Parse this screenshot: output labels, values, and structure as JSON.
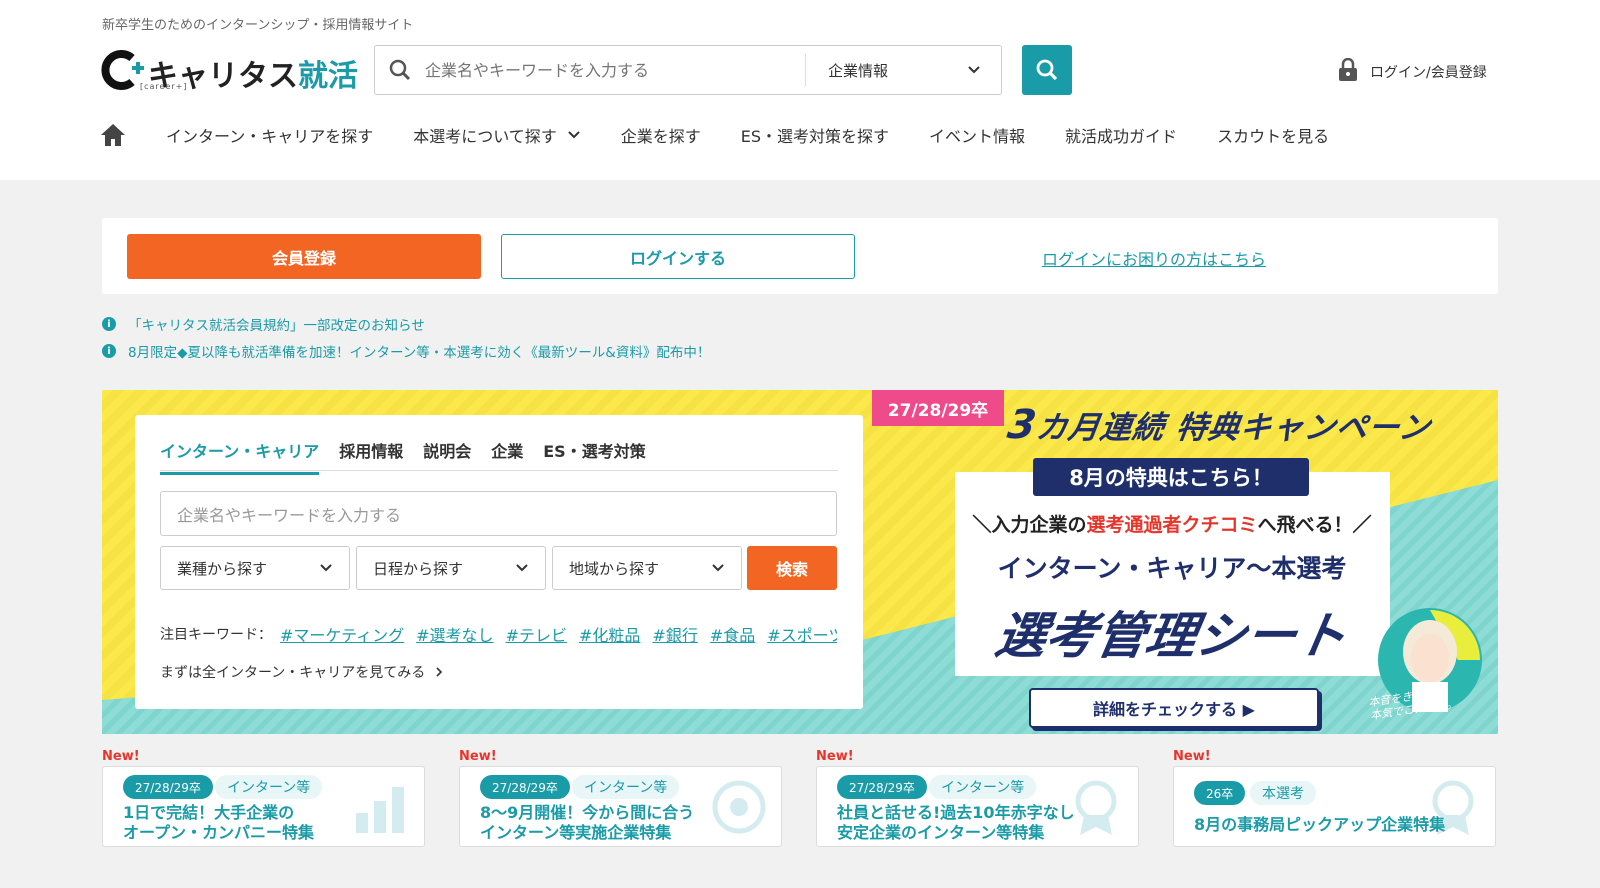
{
  "header": {
    "tagline": "新卒学生のためのインターンシップ・採用情報サイト",
    "logo_main": "キャリタス",
    "logo_accent": "就活",
    "logo_sub": "[career+]",
    "search_placeholder": "企業名やキーワードを入力する",
    "search_select": "企業情報",
    "login_label": "ログイン/会員登録"
  },
  "nav": {
    "items": [
      {
        "label": "インターン・キャリアを探す"
      },
      {
        "label": "本選考について探す"
      },
      {
        "label": "企業を探す"
      },
      {
        "label": "ES・選考対策を探す"
      },
      {
        "label": "イベント情報"
      },
      {
        "label": "就活成功ガイド"
      },
      {
        "label": "スカウトを見る"
      }
    ]
  },
  "account": {
    "register_label": "会員登録",
    "login_label": "ログインする",
    "help_link": "ログインにお困りの方はこちら"
  },
  "notices": [
    "「キャリタス就活会員規約」一部改定のお知らせ",
    "8月限定◆夏以降も就活準備を加速！インターン等・本選考に効く《最新ツール&資料》配布中！"
  ],
  "search_panel": {
    "tabs": [
      "インターン・キャリア",
      "採用情報",
      "説明会",
      "企業",
      "ES・選考対策"
    ],
    "placeholder": "企業名やキーワードを入力する",
    "dropdowns": [
      "業種から探す",
      "日程から探す",
      "地域から探す"
    ],
    "search_button": "検索",
    "keywords_label": "注目キーワード：",
    "keywords": [
      "#マーケティング",
      "#選考なし",
      "#テレビ",
      "#化粧品",
      "#銀行",
      "#食品",
      "#スポーツ"
    ],
    "all_link": "まずは全インターン・キャリアを見てみる"
  },
  "campaign": {
    "years": "27/28/29卒",
    "title_num": "3",
    "title": "カ月連続 特典キャンペーン",
    "month_tag": "8月の特典はこちら！",
    "line1_pre": "＼入力企業の",
    "line1_red": "選考通過者クチコミ",
    "line1_post": "へ飛べる！／",
    "line2": "インターン・キャリア〜本選考",
    "line3": "選考管理シート",
    "detail_button": "詳細をチェックする ▶",
    "character_caption": "本音をきく。\n本気でこたえる。"
  },
  "features": [
    {
      "new": "New!",
      "badge": "27/28/29卒",
      "category": "インターン等",
      "title": "1日で完結！大手企業の\nオープン・カンパニー特集",
      "bg_icon": "chart-icon"
    },
    {
      "new": "New!",
      "badge": "27/28/29卒",
      "category": "インターン等",
      "title": "8〜9月開催！今から間に合う\nインターン等実施企業特集",
      "bg_icon": "target-icon"
    },
    {
      "new": "New!",
      "badge": "27/28/29卒",
      "category": "インターン等",
      "title": "社員と話せる!過去10年赤字なし\n安定企業のインターン等特集",
      "bg_icon": "medal-icon"
    },
    {
      "new": "New!",
      "badge": "26卒",
      "category": "本選考",
      "title": "8月の事務局ピックアップ企業特集",
      "bg_icon": "medal-icon"
    }
  ],
  "colors": {
    "teal": "#1a9ba8",
    "orange": "#f26522",
    "navy": "#1f2f6b",
    "pink": "#ef4a8a",
    "yellow": "#fbe94b"
  }
}
